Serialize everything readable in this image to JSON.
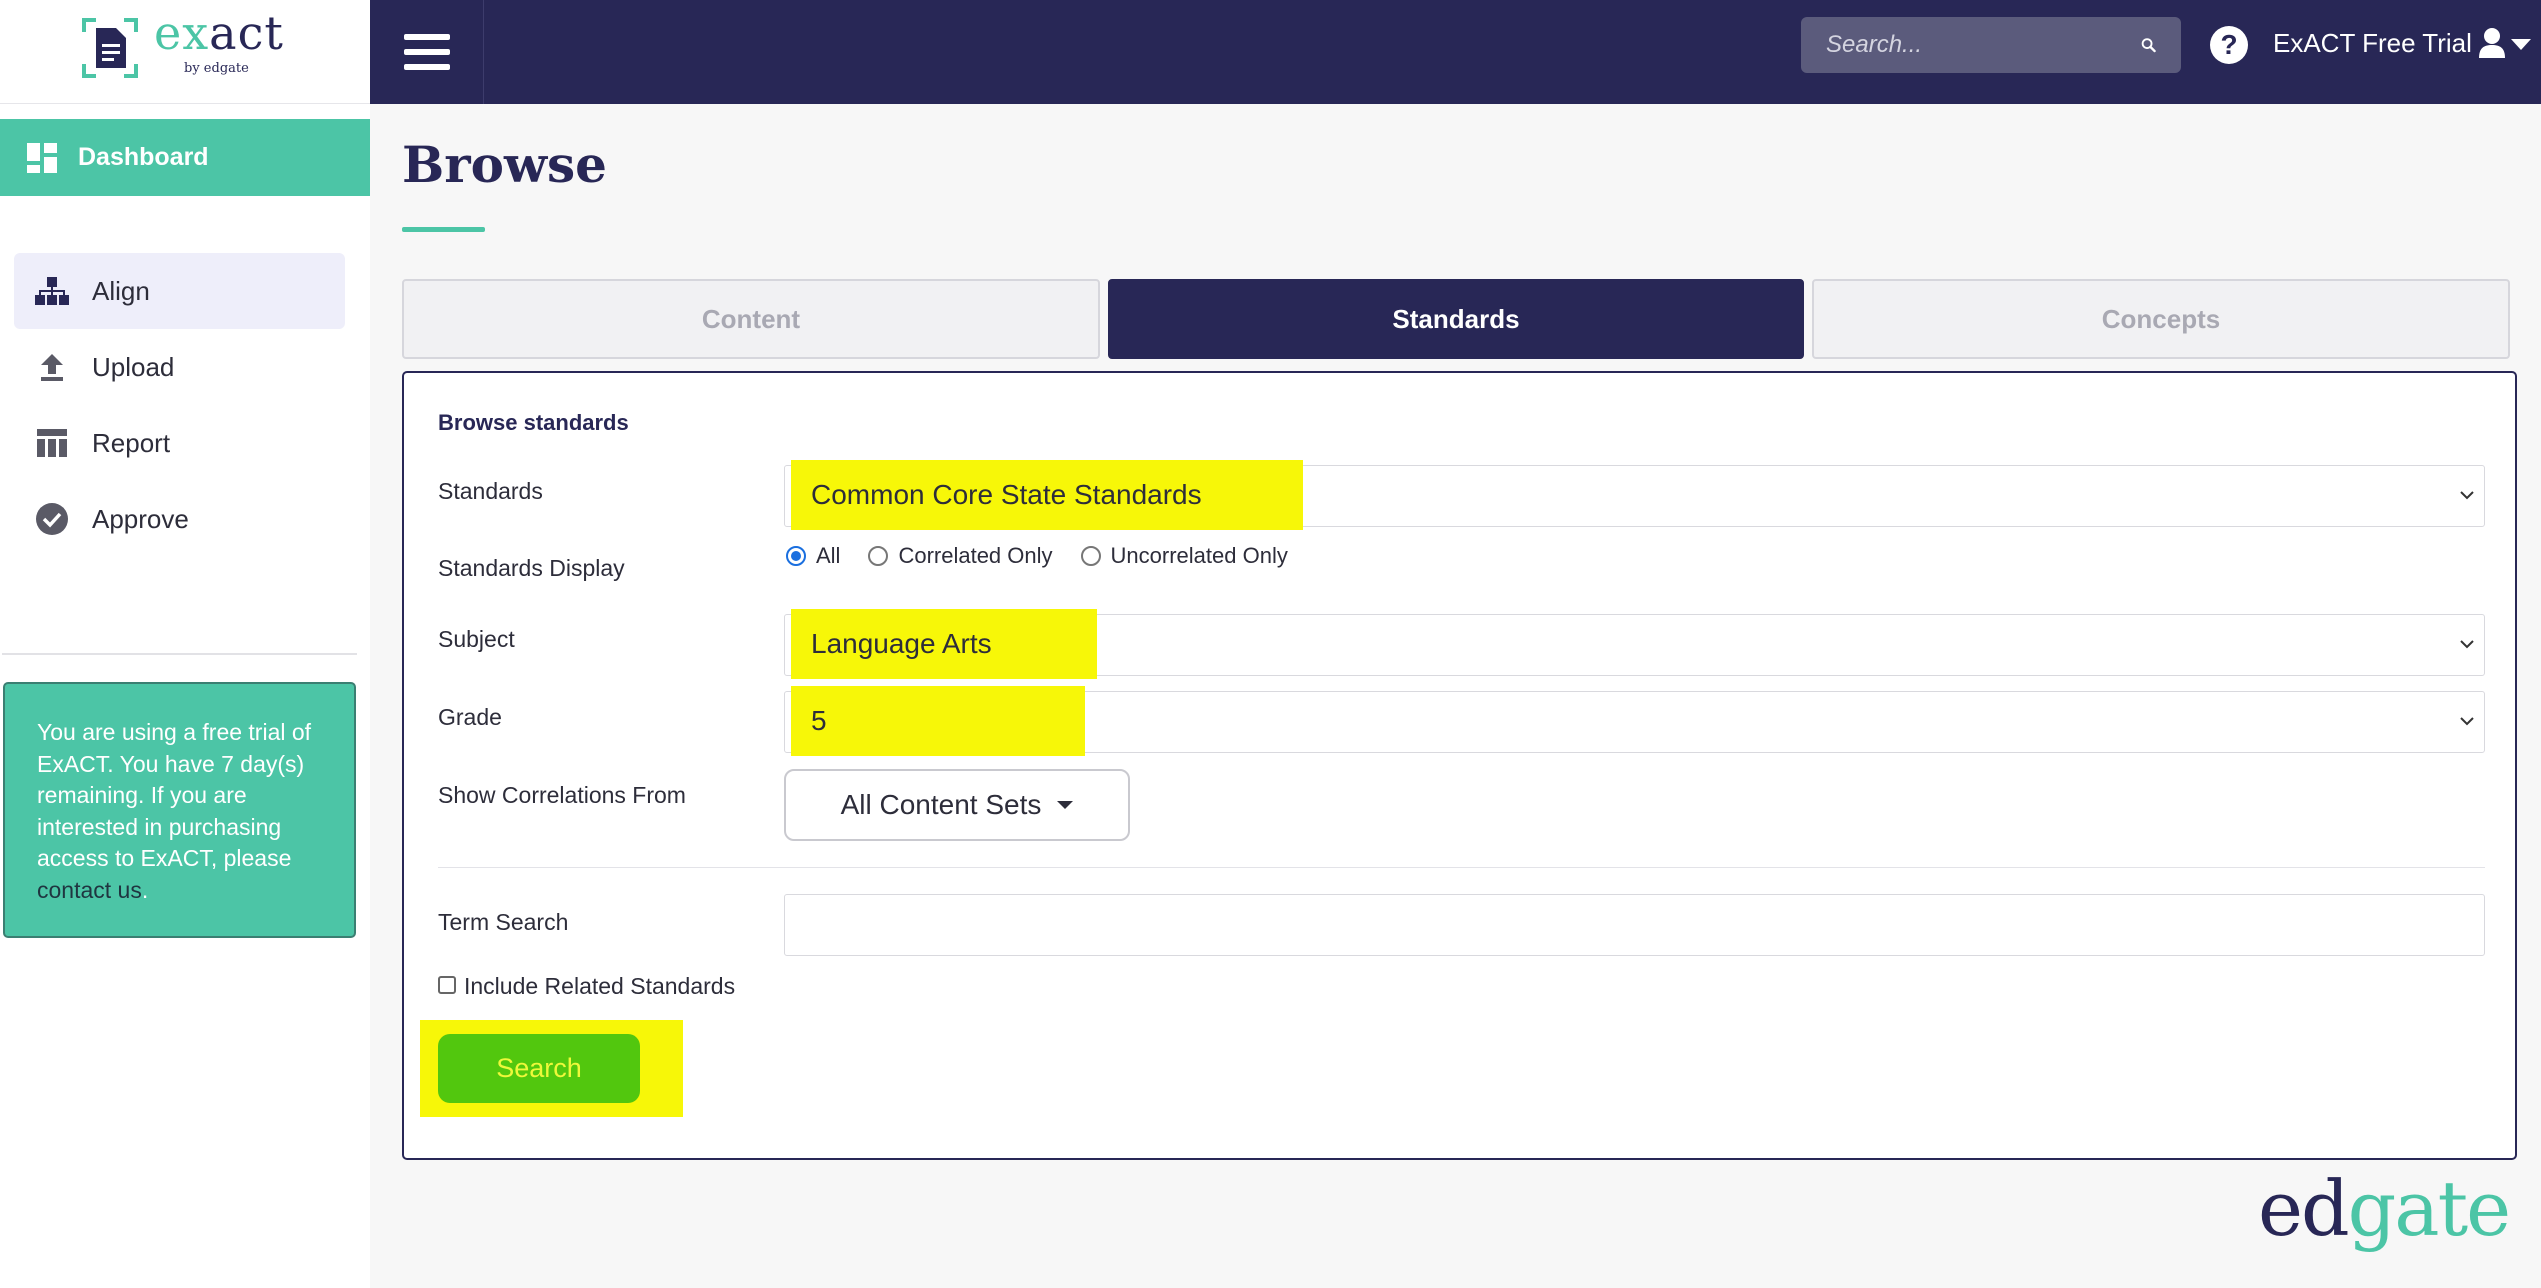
{
  "app": {
    "logo_word_prefix": "ex",
    "logo_word_suffix": "act",
    "logo_sub": "by edgate",
    "footer_logo_ed": "ed",
    "footer_logo_gate": "gate"
  },
  "header": {
    "search_placeholder": "Search...",
    "user_name": "ExACT Free Trial"
  },
  "sidebar": {
    "dashboard_label": "Dashboard",
    "items": [
      {
        "label": "Align",
        "icon": "align-icon",
        "active": true
      },
      {
        "label": "Upload",
        "icon": "upload-icon"
      },
      {
        "label": "Report",
        "icon": "report-icon"
      },
      {
        "label": "Approve",
        "icon": "approve-icon"
      }
    ],
    "trial_text": "You are using a free trial of ExACT. You have 7 day(s) remaining. If you are interested in purchasing access to ExACT, please ",
    "trial_link": "contact us",
    "trial_end": "."
  },
  "main": {
    "title": "Browse",
    "tabs": [
      "Content",
      "Standards",
      "Concepts"
    ],
    "active_tab": "Standards",
    "panel_heading": "Browse standards",
    "labels": {
      "standards": "Standards",
      "standards_display": "Standards Display",
      "subject": "Subject",
      "grade": "Grade",
      "show_correlations": "Show Correlations From",
      "term_search": "Term Search",
      "include_related": "Include Related Standards"
    },
    "standards_value": "Common Core State Standards",
    "display_options": [
      "All",
      "Correlated Only",
      "Uncorrelated Only"
    ],
    "display_selected": "All",
    "subject_value": "Language Arts",
    "grade_value": "5",
    "correlations_button": "All Content Sets",
    "term_search_value": "",
    "include_related_checked": false,
    "search_button": "Search"
  },
  "colors": {
    "navy": "#282756",
    "teal": "#4cc5a6",
    "highlight": "#f7f708",
    "search_green": "#52c70e"
  }
}
